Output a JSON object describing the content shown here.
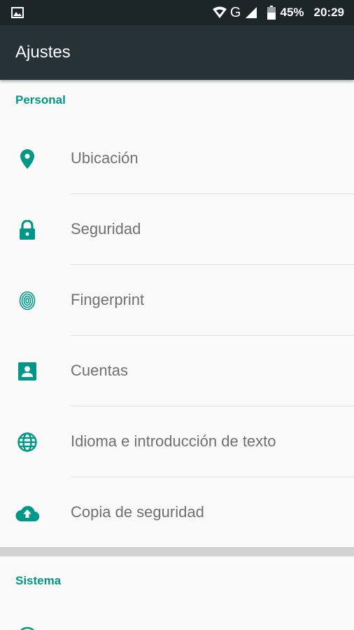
{
  "status_bar": {
    "battery": "45%",
    "network": "G",
    "time": "20:29",
    "icons": [
      "image-notification-icon",
      "wifi-icon",
      "signal-icon",
      "battery-icon"
    ]
  },
  "app_bar": {
    "title": "Ajustes"
  },
  "sections": {
    "personal": {
      "header": "Personal"
    },
    "sistema": {
      "header": "Sistema"
    }
  },
  "items": [
    {
      "label": "Ubicación",
      "icon": "location-icon"
    },
    {
      "label": "Seguridad",
      "icon": "lock-icon"
    },
    {
      "label": "Fingerprint",
      "icon": "fingerprint-icon"
    },
    {
      "label": "Cuentas",
      "icon": "account-icon"
    },
    {
      "label": "Idioma e introducción de texto",
      "icon": "globe-icon"
    },
    {
      "label": "Copia de seguridad",
      "icon": "cloud-upload-icon"
    }
  ],
  "colors": {
    "accent": "#009688",
    "app_bar": "#263238",
    "status_bar": "#1c2628",
    "text": "#707070"
  }
}
